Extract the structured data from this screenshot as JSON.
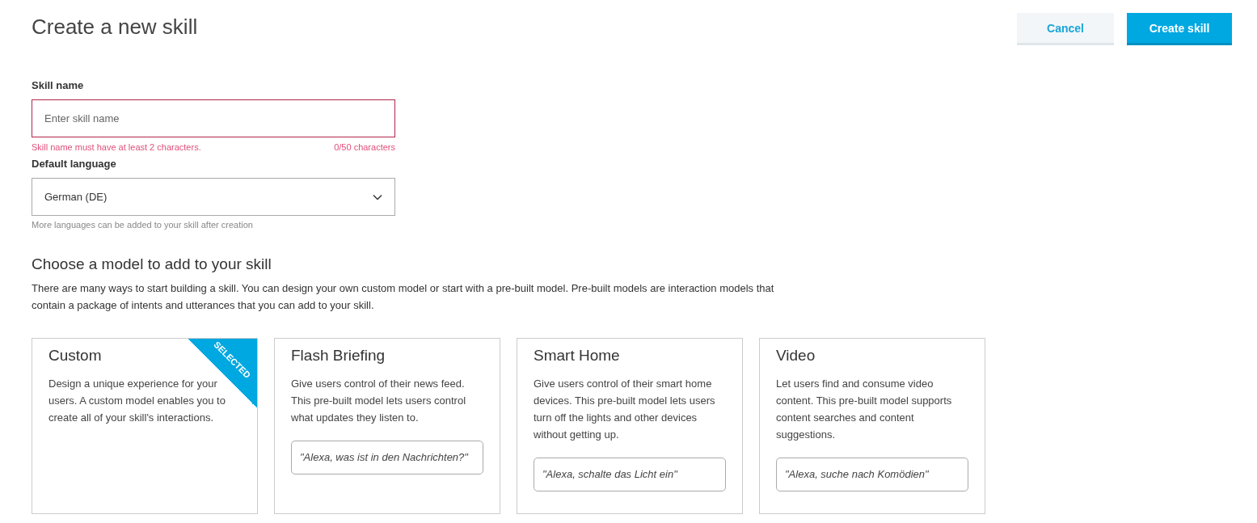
{
  "title": "Create a new skill",
  "buttons": [
    {
      "label": "Cancel",
      "kind": "secondary"
    },
    {
      "label": "Create skill",
      "kind": "primary"
    }
  ],
  "skill_name": {
    "label": "Skill name",
    "placeholder": "Enter skill name",
    "error": "Skill name must have at least 2 characters.",
    "counter": "0/50  characters",
    "invalid": true
  },
  "default_language": {
    "label": "Default language",
    "value": "German (DE)",
    "hint": "More languages can be added to your skill after creation"
  },
  "models": {
    "heading": "Choose a model to add to your skill",
    "description": "There are many ways to start building a skill. You can design your own custom model or start with a pre-built model.  Pre-built models are interaction models that contain a package of intents and utterances that you can add to your skill.",
    "selected_badge": "SELECTED",
    "cards": [
      {
        "title": "Custom",
        "text": "Design a unique experience for your users. A custom model enables you to create all of your skill's interactions.",
        "selected": true
      },
      {
        "title": "Flash Briefing",
        "text": "Give users control of their news feed. This pre-built model lets users control what updates they listen to.",
        "example": "\"Alexa, was ist in den Nachrichten?\"",
        "selected": false
      },
      {
        "title": "Smart Home",
        "text": "Give users control of their smart home devices. This pre-built model lets users turn off the lights and other devices without getting up.",
        "example": "\"Alexa, schalte das Licht ein\"",
        "selected": false
      },
      {
        "title": "Video",
        "text": "Let users find and consume video content. This pre-built model supports content searches and content suggestions.",
        "example": "\"Alexa, suche nach Komödien\"",
        "selected": false
      }
    ]
  }
}
